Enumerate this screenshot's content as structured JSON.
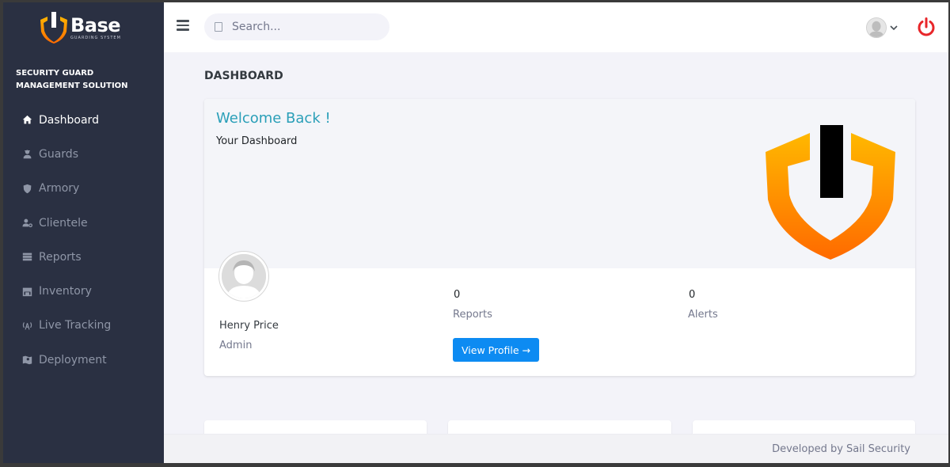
{
  "brand": {
    "name": "Base",
    "subtitle": "GUARDING SYSTEM"
  },
  "sidebar": {
    "tagline": "SECURITY GUARD MANAGEMENT SOLUTION",
    "items": [
      {
        "label": "Dashboard",
        "icon": "home-icon",
        "active": true
      },
      {
        "label": "Guards",
        "icon": "guard-icon",
        "active": false
      },
      {
        "label": "Armory",
        "icon": "shield-icon",
        "active": false
      },
      {
        "label": "Clientele",
        "icon": "user-key-icon",
        "active": false
      },
      {
        "label": "Reports",
        "icon": "server-icon",
        "active": false
      },
      {
        "label": "Inventory",
        "icon": "store-icon",
        "active": false
      },
      {
        "label": "Live Tracking",
        "icon": "broadcast-icon",
        "active": false
      },
      {
        "label": "Deployment",
        "icon": "map-user-icon",
        "active": false
      }
    ]
  },
  "topbar": {
    "search_placeholder": "Search..."
  },
  "page": {
    "title": "DASHBOARD"
  },
  "welcome": {
    "heading": "Welcome Back !",
    "subheading": "Your Dashboard",
    "user_name": "Henry Price",
    "user_role": "Admin",
    "reports_count": "0",
    "reports_label": "Reports",
    "alerts_count": "0",
    "alerts_label": "Alerts",
    "view_profile_label": "View Profile →"
  },
  "footer": {
    "text": "Developed by Sail Security"
  },
  "colors": {
    "sidebar_bg": "#2a3042",
    "accent_teal": "#2a9fb8",
    "primary_button": "#0d8bf2",
    "power_red": "#e8262a",
    "logo_orange": "#ff8a00",
    "logo_yellow": "#ffb400"
  }
}
